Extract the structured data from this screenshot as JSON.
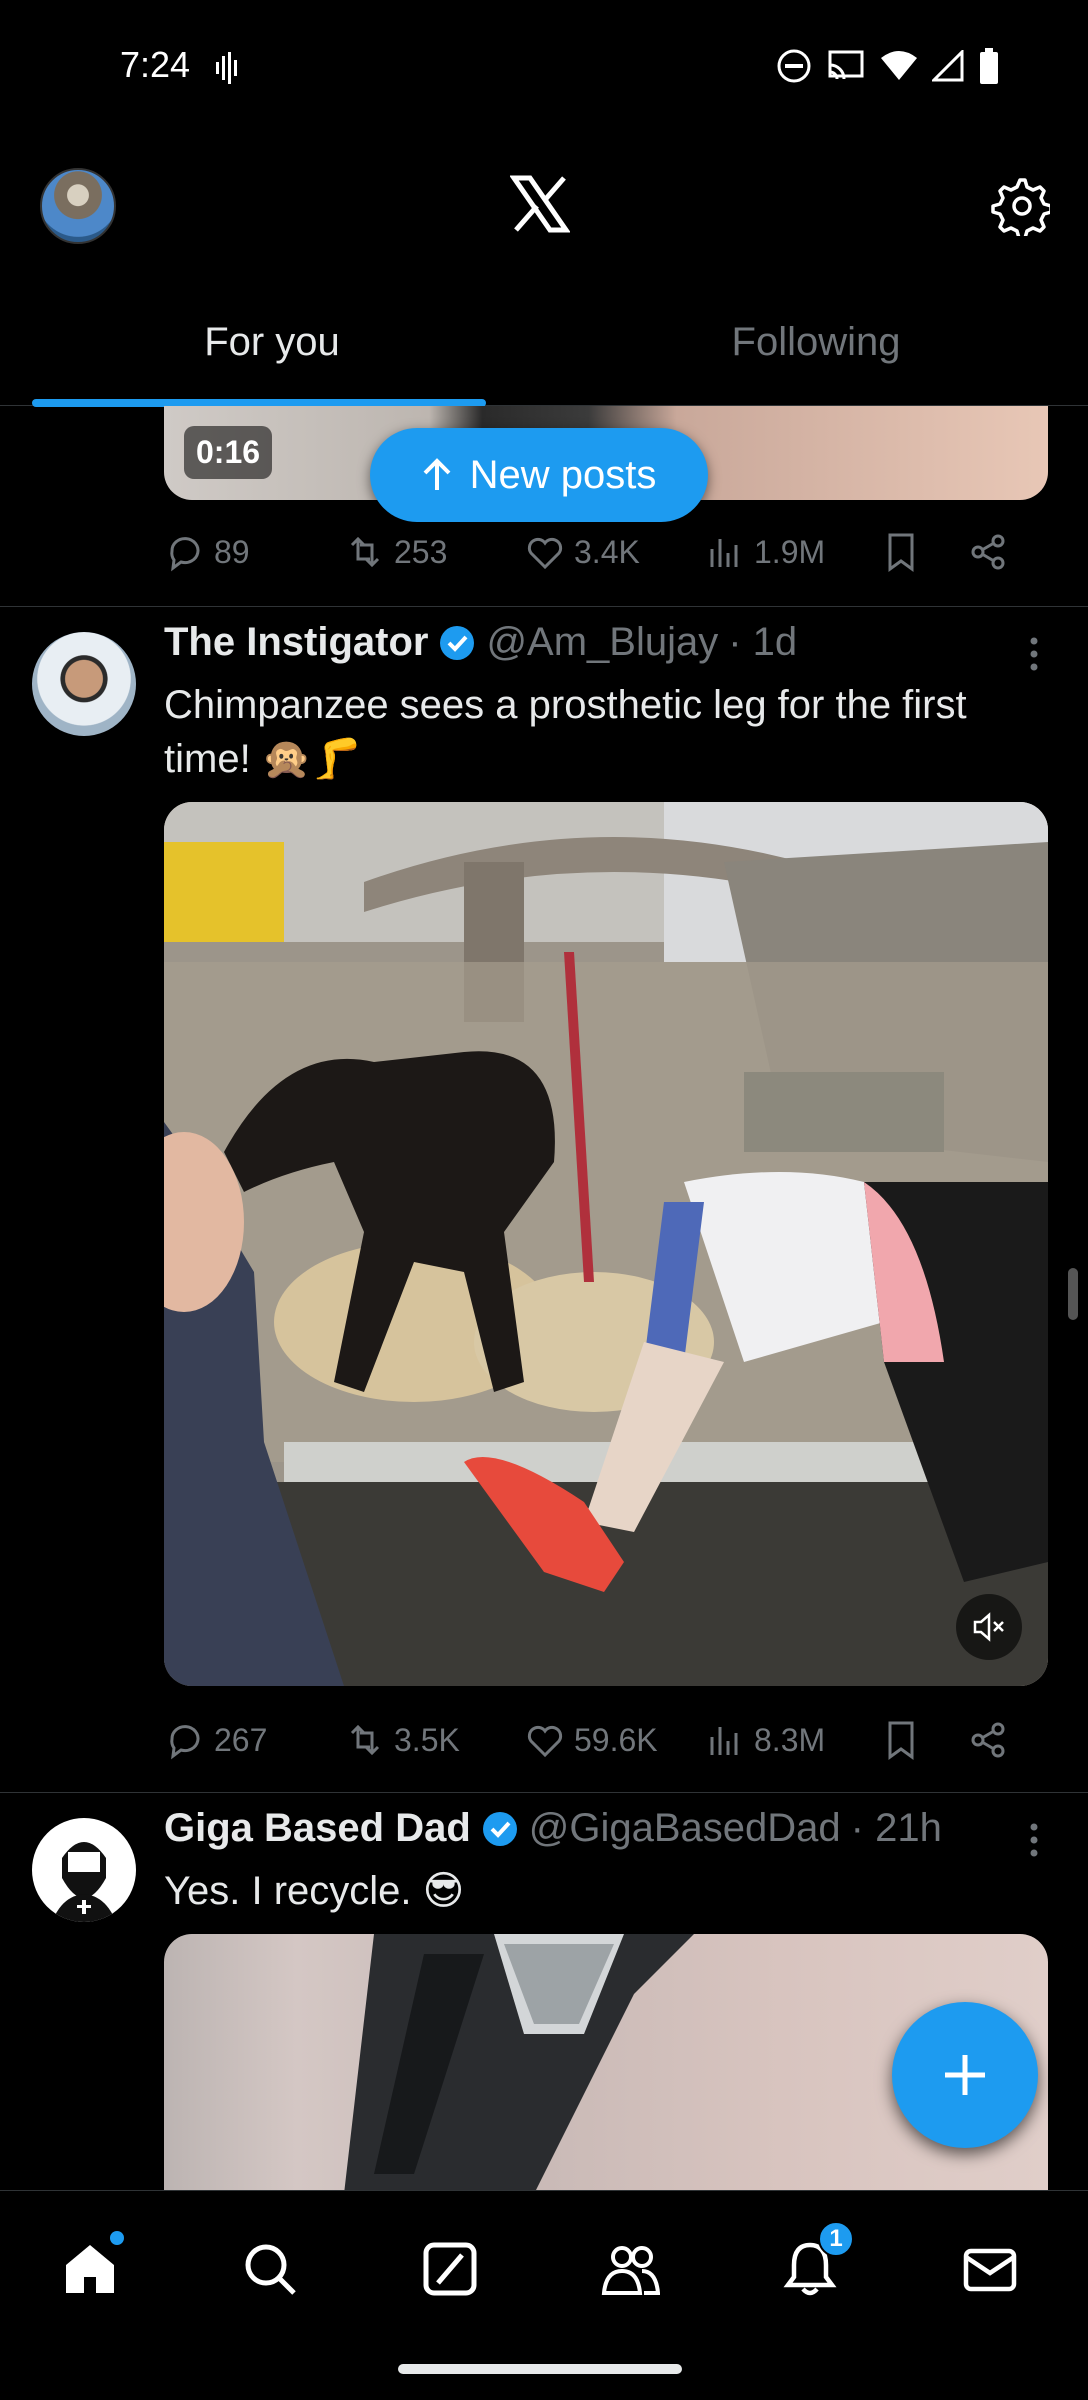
{
  "status_bar": {
    "time": "7:24"
  },
  "tabs": [
    {
      "label": "For you",
      "active": true
    },
    {
      "label": "Following",
      "active": false
    }
  ],
  "prev_tweet": {
    "duration": "0:16",
    "stats": {
      "replies": "89",
      "reposts": "253",
      "likes": "3.4K",
      "views": "1.9M"
    }
  },
  "new_posts_label": "New posts",
  "tweets": [
    {
      "name": "The Instigator",
      "handle": "@Am_Blujay",
      "time": "· 1d",
      "text": "Chimpanzee sees a prosthetic leg for the first time! 🙊🦵",
      "stats": {
        "replies": "267",
        "reposts": "3.5K",
        "likes": "59.6K",
        "views": "8.3M"
      }
    },
    {
      "name": "Giga Based Dad",
      "handle": "@GigaBasedDad",
      "time": "· 21h",
      "text": "Yes. I recycle. 😎"
    }
  ],
  "nav": {
    "notifications_badge": "1"
  },
  "colors": {
    "accent": "#1d9bf0",
    "background": "#000000",
    "muted": "#71767b",
    "text": "#e7e9ea"
  }
}
